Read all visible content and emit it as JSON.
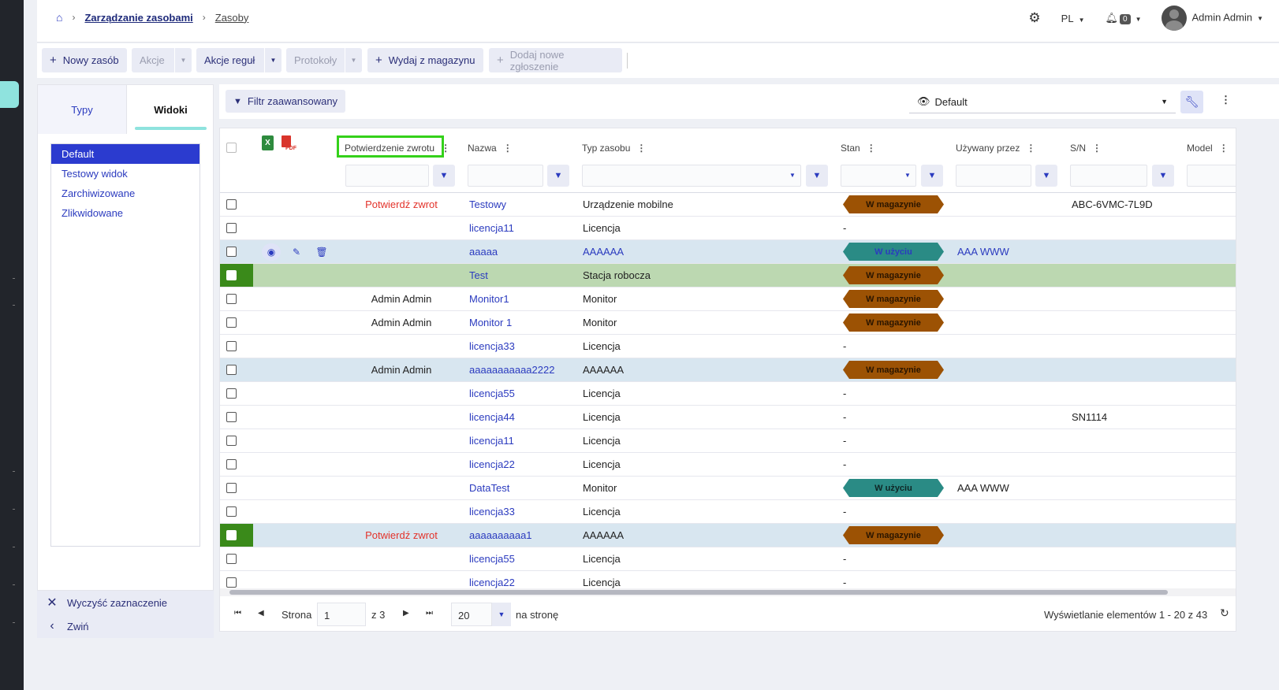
{
  "breadcrumb": {
    "level1": "Zarządzanie zasobami",
    "level2": "Zasoby"
  },
  "header": {
    "language": "PL",
    "notif_count": "0",
    "user": "Admin Admin"
  },
  "toolbar": {
    "new_asset": "Nowy zasób",
    "actions": "Akcje",
    "rule_actions": "Akcje reguł",
    "protocols": "Protokoły",
    "issue_from_stock": "Wydaj z magazynu",
    "add_request": "Dodaj nowe zgłoszenie"
  },
  "sidebar": {
    "tab_types": "Typy",
    "tab_views": "Widoki",
    "views": [
      "Default",
      "Testowy widok",
      "Zarchiwizowane",
      "Zlikwidowane"
    ],
    "clear": "Wyczyść zaznaczenie",
    "collapse": "Zwiń"
  },
  "filterbar": {
    "advanced": "Filtr zaawansowany",
    "view": "Default"
  },
  "grid": {
    "columns": [
      "Potwierdzenie zwrotu",
      "Nazwa",
      "Typ zasobu",
      "Stan",
      "Używany przez",
      "S/N",
      "Model"
    ],
    "rows": [
      {
        "confirm": "Potwierdź zwrot",
        "name": "Testowy",
        "type": "Urządzenie mobilne",
        "status": "W magazynie",
        "user": "",
        "sn": "ABC-6VMC-7L9D"
      },
      {
        "confirm": "",
        "name": "licencja11",
        "type": "Licencja",
        "status": "-",
        "user": "",
        "sn": ""
      },
      {
        "confirm": "",
        "name": "aaaaa",
        "type": "AAAAAA",
        "status": "W użyciu",
        "user": "AAA WWW",
        "sn": ""
      },
      {
        "confirm": "",
        "name": "Test",
        "type": "Stacja robocza",
        "status": "W magazynie",
        "user": "",
        "sn": ""
      },
      {
        "confirm": "Admin Admin",
        "name": "Monitor1",
        "type": "Monitor",
        "status": "W magazynie",
        "user": "",
        "sn": ""
      },
      {
        "confirm": "Admin Admin",
        "name": "Monitor 1",
        "type": "Monitor",
        "status": "W magazynie",
        "user": "",
        "sn": ""
      },
      {
        "confirm": "",
        "name": "licencja33",
        "type": "Licencja",
        "status": "-",
        "user": "",
        "sn": ""
      },
      {
        "confirm": "Admin Admin",
        "name": "aaaaaaaaaaa2222",
        "type": "AAAAAA",
        "status": "W magazynie",
        "user": "",
        "sn": ""
      },
      {
        "confirm": "",
        "name": "licencja55",
        "type": "Licencja",
        "status": "-",
        "user": "",
        "sn": ""
      },
      {
        "confirm": "",
        "name": "licencja44",
        "type": "Licencja",
        "status": "-",
        "user": "",
        "sn": "SN1114"
      },
      {
        "confirm": "",
        "name": "licencja11",
        "type": "Licencja",
        "status": "-",
        "user": "",
        "sn": ""
      },
      {
        "confirm": "",
        "name": "licencja22",
        "type": "Licencja",
        "status": "-",
        "user": "",
        "sn": ""
      },
      {
        "confirm": "",
        "name": "DataTest",
        "type": "Monitor",
        "status": "W użyciu",
        "user": "AAA WWW",
        "sn": ""
      },
      {
        "confirm": "",
        "name": "licencja33",
        "type": "Licencja",
        "status": "-",
        "user": "",
        "sn": ""
      },
      {
        "confirm": "Potwierdź zwrot",
        "name": "aaaaaaaaaa1",
        "type": "AAAAAA",
        "status": "W magazynie",
        "user": "",
        "sn": ""
      },
      {
        "confirm": "",
        "name": "licencja55",
        "type": "Licencja",
        "status": "-",
        "user": "",
        "sn": ""
      },
      {
        "confirm": "",
        "name": "licencja22",
        "type": "Licencja",
        "status": "-",
        "user": "",
        "sn": ""
      }
    ]
  },
  "pager": {
    "page_label": "Strona",
    "page": "1",
    "of": "z 3",
    "per_page": "20",
    "per_page_label": "na stronę",
    "summary": "Wyświetlanie elementów 1 - 20 z 43"
  }
}
